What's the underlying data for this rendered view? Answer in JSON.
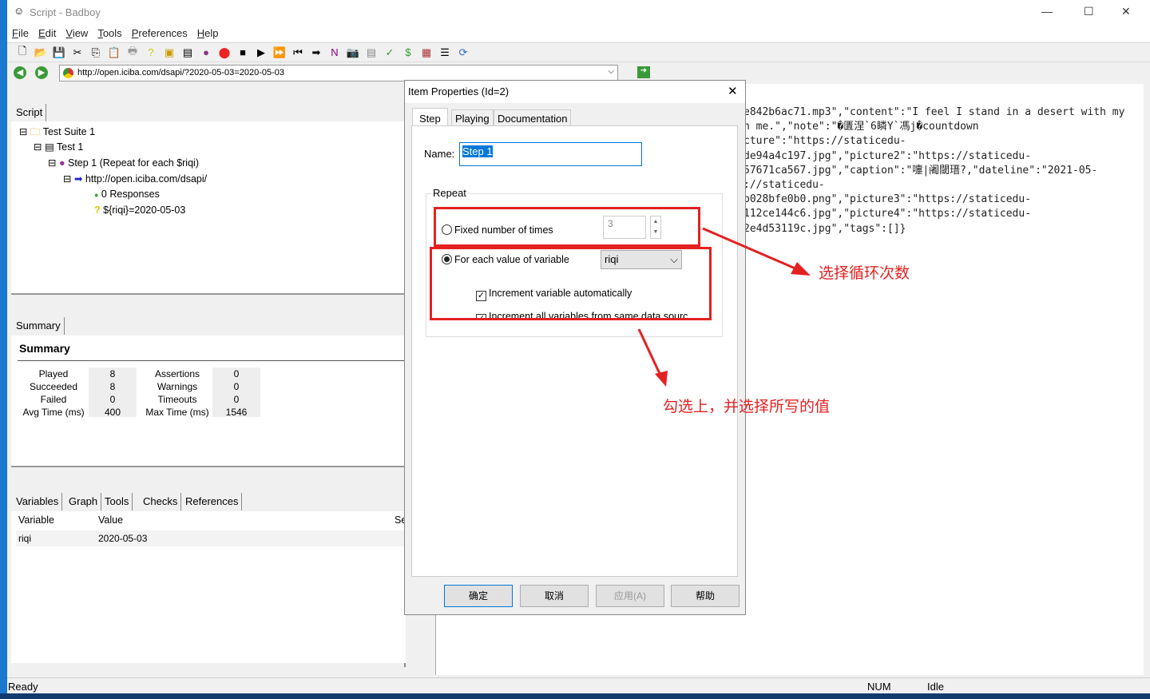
{
  "window": {
    "title": "Script - Badboy"
  },
  "menu": [
    "File",
    "Edit",
    "View",
    "Tools",
    "Preferences",
    "Help"
  ],
  "toolbar_icons": [
    "new-icon",
    "open-icon",
    "save-icon",
    "cut-icon",
    "copy-icon",
    "paste-icon",
    "print-icon",
    "help-icon",
    "add-suite-icon",
    "add-test-icon",
    "add-step-icon",
    "record-icon",
    "stop-icon",
    "play-icon",
    "play-all-icon",
    "rewind-icon",
    "step-forward-icon",
    "navigation-icon",
    "screenshot-icon",
    "report-icon",
    "check-icon",
    "variable-icon",
    "table-icon",
    "tree-icon",
    "refresh-icon"
  ],
  "address": {
    "url": "http://open.iciba.com/dsapi/?2020-05-03=2020-05-03"
  },
  "script_tab": "Script",
  "tree": {
    "suite": "Test Suite 1",
    "test": "Test 1",
    "step": "Step 1 (Repeat for each $riqi)",
    "request": "http://open.iciba.com/dsapi/",
    "responses": "0 Responses",
    "variable": "${riqi}=2020-05-03"
  },
  "summary": {
    "tab": "Summary",
    "heading": "Summary",
    "left": [
      [
        "Played",
        "8"
      ],
      [
        "Succeeded",
        "8"
      ],
      [
        "Failed",
        "0"
      ],
      [
        "Avg Time (ms)",
        "400"
      ]
    ],
    "right": [
      [
        "Assertions",
        "0"
      ],
      [
        "Warnings",
        "0"
      ],
      [
        "Timeouts",
        "0"
      ],
      [
        "Max Time (ms)",
        "1546"
      ]
    ]
  },
  "bottom_tabs": [
    "Variables",
    "Graph",
    "Tools",
    "Checks",
    "References"
  ],
  "variables": {
    "headers": [
      "Variable",
      "Value",
      "Se"
    ],
    "rows": [
      [
        "riqi",
        "2020-05-03"
      ]
    ]
  },
  "response_lines": [
    "e842b6ac71.mp3\",\"content\":\"I feel I stand in a desert with my",
    "n me.\",\"note\":\"�匱涅`6瞵Y`馮j�countdown",
    "cture\":\"https://staticedu-",
    "de94a4c197.jpg\",\"picture2\":\"https://staticedu-",
    "57671ca567.jpg\",\"caption\":\"嚏|阇閾瑨?,\"dateline\":\"2021-05-",
    "://staticedu-",
    "b028bfe0b0.png\",\"picture3\":\"https://staticedu-",
    "112ce144c6.jpg\",\"picture4\":\"https://staticedu-",
    "2e4d53119c.jpg\",\"tags\":[]}"
  ],
  "status": {
    "left": "Ready",
    "num": "NUM",
    "state": "Idle"
  },
  "dialog": {
    "title": "Item Properties (Id=2)",
    "tabs": [
      "Step",
      "Playing",
      "Documentation"
    ],
    "name_label": "Name:",
    "name_value": "Step 1",
    "repeat_label": "Repeat",
    "fixed_label": "Fixed number of times",
    "fixed_value": "3",
    "foreach_label": "For each value of variable",
    "foreach_value": "riqi",
    "inc_auto": "Increment variable automatically",
    "inc_all": "Increment all variables from same data sourc",
    "buttons": [
      "确定",
      "取消",
      "应用(A)",
      "帮助"
    ]
  },
  "annotations": {
    "a1": "选择循环次数",
    "a2": "勾选上，并选择所写的值"
  },
  "colors": {
    "annotation": "#e42121",
    "selection": "#0078d7"
  }
}
